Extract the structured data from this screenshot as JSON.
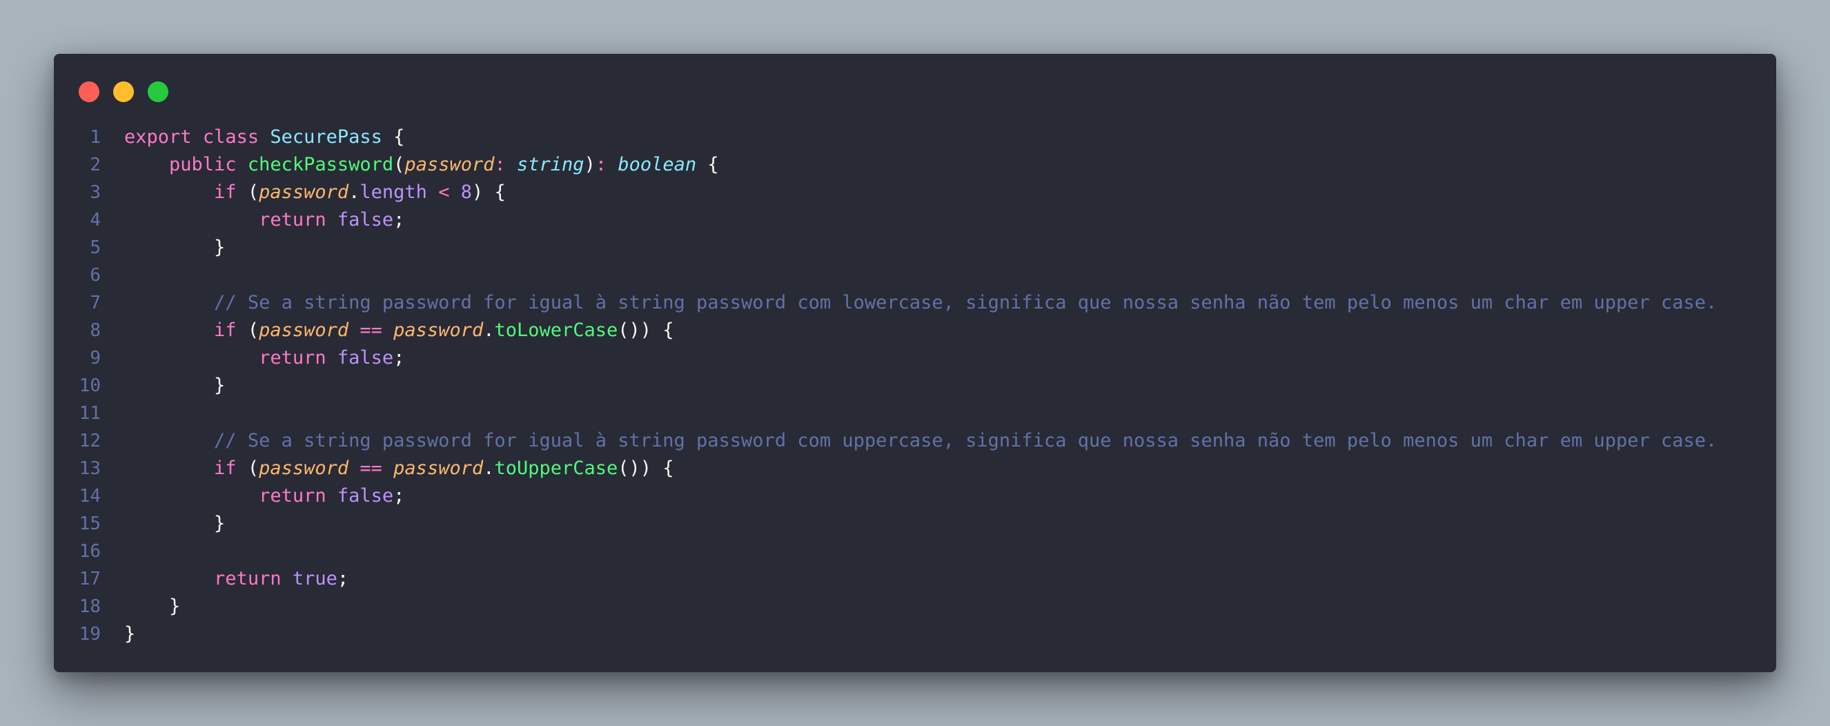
{
  "colors": {
    "background": "#a9b4bd",
    "editor_background": "#282a36",
    "line_number": "#6272a4",
    "keyword": "#ff79c6",
    "class_name": "#8be9fd",
    "function": "#50fa7b",
    "parameter": "#ffb86c",
    "type": "#8be9fd",
    "property_and_constant": "#bd93f9",
    "comment": "#6272a4",
    "text": "#f8f8f2"
  },
  "window_controls": {
    "close_icon": "red-dot-close-icon",
    "minimize_icon": "yellow-dot-minimize-icon",
    "maximize_icon": "green-dot-maximize-icon"
  },
  "code": {
    "lines": [
      {
        "number": "1",
        "tokens": [
          {
            "t": "export",
            "c": "keyword"
          },
          {
            "t": " ",
            "c": "plain"
          },
          {
            "t": "class",
            "c": "storage"
          },
          {
            "t": " ",
            "c": "plain"
          },
          {
            "t": "SecurePass",
            "c": "class_name"
          },
          {
            "t": " {",
            "c": "punct"
          }
        ]
      },
      {
        "number": "2",
        "tokens": [
          {
            "t": "    ",
            "c": "plain"
          },
          {
            "t": "public",
            "c": "keyword"
          },
          {
            "t": " ",
            "c": "plain"
          },
          {
            "t": "checkPassword",
            "c": "func"
          },
          {
            "t": "(",
            "c": "punct"
          },
          {
            "t": "password",
            "c": "param"
          },
          {
            "t": ":",
            "c": "op"
          },
          {
            "t": " ",
            "c": "plain"
          },
          {
            "t": "string",
            "c": "type"
          },
          {
            "t": ")",
            "c": "punct"
          },
          {
            "t": ":",
            "c": "op"
          },
          {
            "t": " ",
            "c": "plain"
          },
          {
            "t": "boolean",
            "c": "type"
          },
          {
            "t": " {",
            "c": "punct"
          }
        ]
      },
      {
        "number": "3",
        "tokens": [
          {
            "t": "        ",
            "c": "plain"
          },
          {
            "t": "if",
            "c": "keyword"
          },
          {
            "t": " (",
            "c": "punct"
          },
          {
            "t": "password",
            "c": "param"
          },
          {
            "t": ".",
            "c": "punct"
          },
          {
            "t": "length",
            "c": "prop"
          },
          {
            "t": " ",
            "c": "plain"
          },
          {
            "t": "<",
            "c": "op"
          },
          {
            "t": " ",
            "c": "plain"
          },
          {
            "t": "8",
            "c": "num"
          },
          {
            "t": ") {",
            "c": "punct"
          }
        ]
      },
      {
        "number": "4",
        "tokens": [
          {
            "t": "            ",
            "c": "plain"
          },
          {
            "t": "return",
            "c": "keyword"
          },
          {
            "t": " ",
            "c": "plain"
          },
          {
            "t": "false",
            "c": "const"
          },
          {
            "t": ";",
            "c": "punct"
          }
        ]
      },
      {
        "number": "5",
        "tokens": [
          {
            "t": "        ",
            "c": "plain"
          },
          {
            "t": "}",
            "c": "punct"
          }
        ]
      },
      {
        "number": "6",
        "tokens": []
      },
      {
        "number": "7",
        "tokens": [
          {
            "t": "        ",
            "c": "plain"
          },
          {
            "t": "// Se a string password for igual à string password com lowercase, significa que nossa senha não tem pelo menos um char em upper case.",
            "c": "comment"
          }
        ]
      },
      {
        "number": "8",
        "tokens": [
          {
            "t": "        ",
            "c": "plain"
          },
          {
            "t": "if",
            "c": "keyword"
          },
          {
            "t": " (",
            "c": "punct"
          },
          {
            "t": "password",
            "c": "param"
          },
          {
            "t": " ",
            "c": "plain"
          },
          {
            "t": "==",
            "c": "op"
          },
          {
            "t": " ",
            "c": "plain"
          },
          {
            "t": "password",
            "c": "param"
          },
          {
            "t": ".",
            "c": "punct"
          },
          {
            "t": "toLowerCase",
            "c": "func"
          },
          {
            "t": "()) {",
            "c": "punct"
          }
        ]
      },
      {
        "number": "9",
        "tokens": [
          {
            "t": "            ",
            "c": "plain"
          },
          {
            "t": "return",
            "c": "keyword"
          },
          {
            "t": " ",
            "c": "plain"
          },
          {
            "t": "false",
            "c": "const"
          },
          {
            "t": ";",
            "c": "punct"
          }
        ]
      },
      {
        "number": "10",
        "tokens": [
          {
            "t": "        ",
            "c": "plain"
          },
          {
            "t": "}",
            "c": "punct"
          }
        ]
      },
      {
        "number": "11",
        "tokens": []
      },
      {
        "number": "12",
        "tokens": [
          {
            "t": "        ",
            "c": "plain"
          },
          {
            "t": "// Se a string password for igual à string password com uppercase, significa que nossa senha não tem pelo menos um char em upper case.",
            "c": "comment"
          }
        ]
      },
      {
        "number": "13",
        "tokens": [
          {
            "t": "        ",
            "c": "plain"
          },
          {
            "t": "if",
            "c": "keyword"
          },
          {
            "t": " (",
            "c": "punct"
          },
          {
            "t": "password",
            "c": "param"
          },
          {
            "t": " ",
            "c": "plain"
          },
          {
            "t": "==",
            "c": "op"
          },
          {
            "t": " ",
            "c": "plain"
          },
          {
            "t": "password",
            "c": "param"
          },
          {
            "t": ".",
            "c": "punct"
          },
          {
            "t": "toUpperCase",
            "c": "func"
          },
          {
            "t": "()) {",
            "c": "punct"
          }
        ]
      },
      {
        "number": "14",
        "tokens": [
          {
            "t": "            ",
            "c": "plain"
          },
          {
            "t": "return",
            "c": "keyword"
          },
          {
            "t": " ",
            "c": "plain"
          },
          {
            "t": "false",
            "c": "const"
          },
          {
            "t": ";",
            "c": "punct"
          }
        ]
      },
      {
        "number": "15",
        "tokens": [
          {
            "t": "        ",
            "c": "plain"
          },
          {
            "t": "}",
            "c": "punct"
          }
        ]
      },
      {
        "number": "16",
        "tokens": []
      },
      {
        "number": "17",
        "tokens": [
          {
            "t": "        ",
            "c": "plain"
          },
          {
            "t": "return",
            "c": "keyword"
          },
          {
            "t": " ",
            "c": "plain"
          },
          {
            "t": "true",
            "c": "const"
          },
          {
            "t": ";",
            "c": "punct"
          }
        ]
      },
      {
        "number": "18",
        "tokens": [
          {
            "t": "    ",
            "c": "plain"
          },
          {
            "t": "}",
            "c": "punct"
          }
        ]
      },
      {
        "number": "19",
        "tokens": [
          {
            "t": "}",
            "c": "punct"
          }
        ]
      }
    ]
  }
}
